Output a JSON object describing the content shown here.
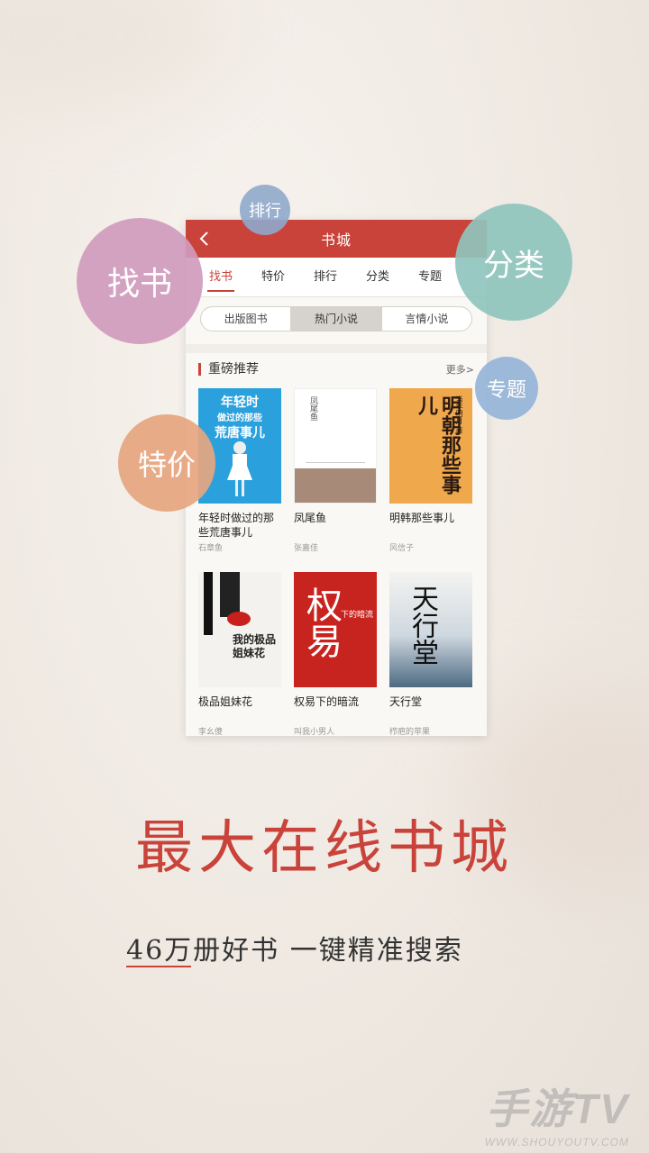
{
  "app": {
    "title": "书城",
    "tabs": [
      "找书",
      "特价",
      "排行",
      "分类",
      "专题"
    ],
    "segments": [
      "出版图书",
      "热门小说",
      "言情小说"
    ],
    "section_title": "重磅推荐",
    "more_label": "更多>",
    "books": [
      {
        "name": "年轻时做过的那些荒唐事儿",
        "author": "石章鱼",
        "cover_text": "年轻时\n做过的那些\n荒唐事儿",
        "cover_bg": "#2aa1dd"
      },
      {
        "name": "凤尾鱼",
        "author": "张嘉佳",
        "cover_text": "凤尾鱼",
        "cover_bg": "#ffffff"
      },
      {
        "name": "明韩那些事儿",
        "author": "风信子",
        "cover_text": "明朝那些事儿",
        "cover_bg": "#f0a84c"
      },
      {
        "name": "极品姐妹花",
        "author": "李幺傻",
        "cover_text": "我的极品\n姐妹花",
        "cover_bg": "#f4f2ee"
      },
      {
        "name": "权易下的暗流",
        "author": "叫我小男人",
        "cover_text": "权易",
        "cover_bg": "#c8241f"
      },
      {
        "name": "天行堂",
        "author": "栉疤的苹果",
        "cover_text": "天行堂",
        "cover_bg": "#cfd8e0"
      }
    ]
  },
  "bubbles": {
    "paihang": "排行",
    "zhaoshu": "找书",
    "fenlei": "分类",
    "zhuanti": "专题",
    "tejia": "特价"
  },
  "headline": "最大在线书城",
  "subline": "46万册好书  一键精准搜索",
  "watermark": {
    "big": "手游TV",
    "small": "WWW.SHOUYOUTV.COM"
  },
  "colors": {
    "accent": "#c9433a",
    "zhaoshu": "#d09bbd",
    "paihang": "#8fa9cc",
    "fenlei": "#8fc4bd",
    "zhuanti": "#96b4d8",
    "tejia": "#e6a57f"
  }
}
